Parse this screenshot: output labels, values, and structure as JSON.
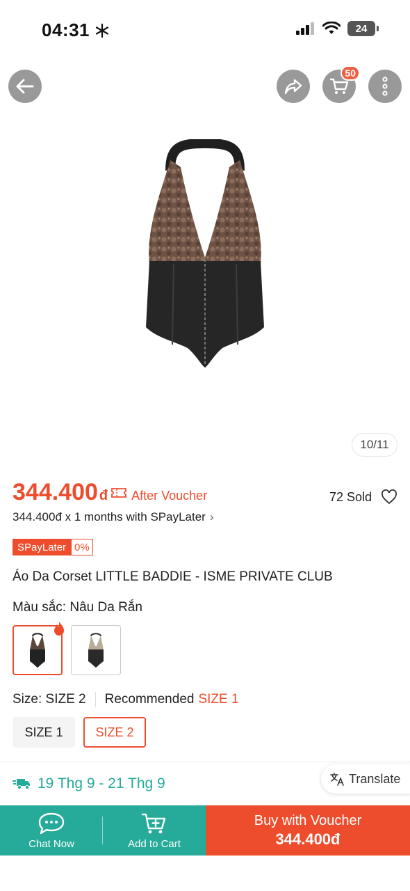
{
  "status_bar": {
    "time": "04:31",
    "battery": "24"
  },
  "header": {
    "cart_count": "50"
  },
  "gallery": {
    "counter": "10/11"
  },
  "price": {
    "amount": "344.400",
    "currency": "đ",
    "after_voucher": "After Voucher",
    "sold": "72 Sold",
    "installment": "344.400đ x 1 months with SPayLater"
  },
  "badge": {
    "left": "SPayLater",
    "right": "0%"
  },
  "product": {
    "title": "Áo Da Corset LITTLE BADDIE - ISME PRIVATE CLUB"
  },
  "color": {
    "label": "Màu sắc:",
    "value": "Nâu Da Rắn"
  },
  "size": {
    "label": "Size:",
    "value": "SIZE 2",
    "recommended_label": "Recommended",
    "recommended_value": "SIZE 1",
    "options": [
      "SIZE 1",
      "SIZE 2"
    ]
  },
  "delivery": {
    "dates": "19 Thg 9 - 21 Thg 9"
  },
  "translate": {
    "label": "Translate"
  },
  "bottom_bar": {
    "chat_label": "Chat Now",
    "cart_label": "Add to Cart",
    "buy_label": "Buy with Voucher",
    "buy_price": "344.400đ"
  },
  "colors": {
    "accent": "#ee4d2d",
    "teal": "#26aa99"
  },
  "icons": [
    "back-arrow-icon",
    "share-icon",
    "cart-icon",
    "more-icon",
    "voucher-icon",
    "heart-icon",
    "fire-icon",
    "delivery-truck-icon",
    "translate-icon",
    "chat-icon",
    "add-cart-icon",
    "snowflake-icon",
    "signal-icon",
    "wifi-icon"
  ]
}
